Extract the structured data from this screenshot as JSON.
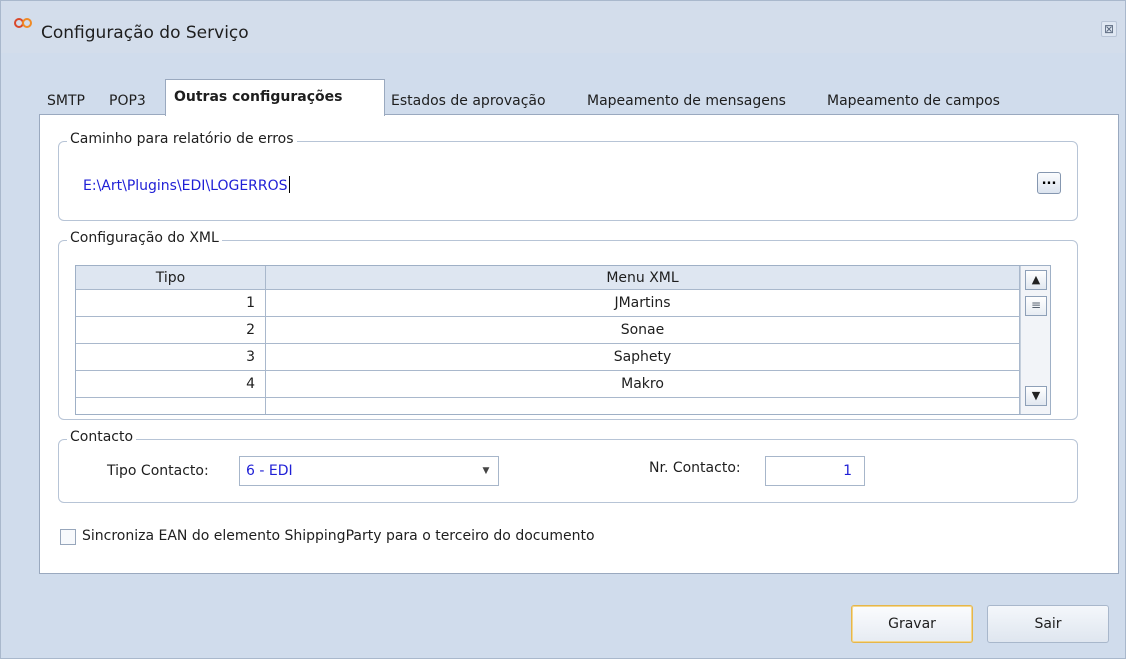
{
  "window": {
    "title": "Configuração do Serviço",
    "close_glyph": "⊠"
  },
  "tabs": [
    {
      "label": "SMTP"
    },
    {
      "label": "POP3"
    },
    {
      "label": "Outras configurações"
    },
    {
      "label": "Estados de aprovação"
    },
    {
      "label": "Mapeamento de mensagens"
    },
    {
      "label": "Mapeamento de campos"
    }
  ],
  "active_tab": "Outras configurações",
  "error_report": {
    "legend": "Caminho para relatório de erros",
    "path": "E:\\Art\\Plugins\\EDI\\LOGERROS",
    "browse_label": "..."
  },
  "xml_config": {
    "legend": "Configuração do XML",
    "columns": [
      "Tipo",
      "Menu XML"
    ],
    "rows": [
      {
        "tipo": "1",
        "menu": "JMartins"
      },
      {
        "tipo": "2",
        "menu": "Sonae"
      },
      {
        "tipo": "3",
        "menu": "Saphety"
      },
      {
        "tipo": "4",
        "menu": "Makro"
      }
    ]
  },
  "contact": {
    "legend": "Contacto",
    "type_label": "Tipo Contacto:",
    "type_value": "6 - EDI",
    "number_label": "Nr. Contacto:",
    "number_value": "1"
  },
  "sync_checkbox": {
    "label": "Sincroniza EAN do elemento ShippingParty para o terceiro do documento",
    "checked": false
  },
  "buttons": {
    "save": "Gravar",
    "exit": "Sair"
  },
  "colors": {
    "value_text": "#1f1fd6",
    "window_bg": "#d0dcec"
  }
}
